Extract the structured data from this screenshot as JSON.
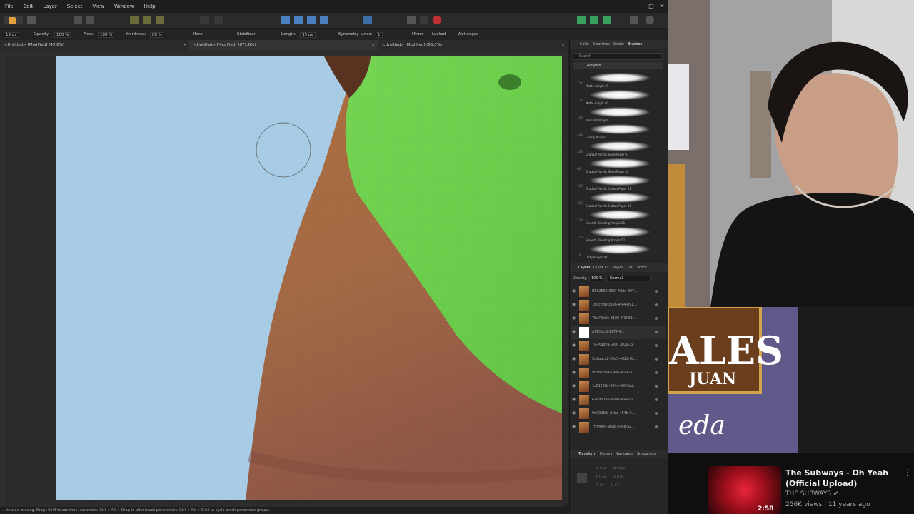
{
  "menu": [
    "File",
    "Edit",
    "Layer",
    "Select",
    "View",
    "Window",
    "Help"
  ],
  "window_controls": {
    "minimize": "–",
    "maximize": "□",
    "close": "✕"
  },
  "context": {
    "size_value": "19 px",
    "opacity_label": "Opacity:",
    "opacity_value": "100 %",
    "flow_label": "Flow:",
    "flow_value": "100 %",
    "hardness_label": "Hardness:",
    "hardness_value": "80 %",
    "more_label": "More",
    "stabilizer_label": "Stabilizer",
    "length_label": "Length:",
    "length_value": "35 px",
    "symmetry_label": "Symmetry",
    "lines_label": "Lines:",
    "lines_value": "1",
    "mirror_label": "Mirror",
    "locked_label": "Locked",
    "wet_edges_label": "Wet edges"
  },
  "doc_tabs": [
    {
      "title": "<Untitled> [Modified] (43.8%)",
      "close": "×"
    },
    {
      "title": "<Untitled> [Modified] (871.6%)",
      "close": "×"
    },
    {
      "title": "<Untitled> [Modified] (55.3%)",
      "close": "×"
    }
  ],
  "status_text": "... to start erasing. Drag+Shift to continue last stroke. Ctrl + Alt + Drag to alter brush parameters. Ctrl + Alt + Click to cycle brush parameter groups.",
  "panel_top_tabs": [
    "Color",
    "Swatches",
    "Stroke",
    "Brushes"
  ],
  "brush_search_placeholder": "Search",
  "brush_category": "Acrylics",
  "brushes": [
    {
      "num": "128",
      "name": "Matte Acrylic 01"
    },
    {
      "num": "128",
      "name": "Matte Acrylic 02"
    },
    {
      "num": "140",
      "name": "Textured Acrylic"
    },
    {
      "num": "128",
      "name": "Grainy Acrylic"
    },
    {
      "num": "128",
      "name": "Gradual Acrylic Seed Paper 01"
    },
    {
      "num": "60",
      "name": "Gradual Acrylic Seed Paper 02"
    },
    {
      "num": "128",
      "name": "Gradual Acrylic Cotton Paper 01"
    },
    {
      "num": "128",
      "name": "Gradual Acrylic Cotton Paper 02"
    },
    {
      "num": "128",
      "name": "Smooth Blending Acrylic 01"
    },
    {
      "num": "120",
      "name": "Smooth Blending Acrylic 02"
    },
    {
      "num": "72",
      "name": "Dirty Acrylic 01"
    }
  ],
  "layer_tabs": [
    "Layers",
    "Quick FX",
    "Styles",
    "Tilt",
    "Stock"
  ],
  "layer_opacity_label": "Opacity:",
  "layer_opacity_value": "100 %",
  "blend_mode": "Normal",
  "layers": [
    "ff3b2509-0f80-48dd-807...",
    "160cfd6f-3e26-4fe4-891...",
    "78a79e8e-8108-4f1f-93...",
    "a795fcc8-2177-4...",
    "1bd5447d-b881-454b-9...",
    "5d2aacc2-24a5-4022-82...",
    "95a87504-1a88-4c48-a...",
    "1c81238c-364c-48fd-bd...",
    "42693056-e5bd-466a-b...",
    "9d0926fb-d1ba-454b-9...",
    "7ff6fb00-98ab-34c8-a2..."
  ],
  "bottom_tabs": [
    "Transform",
    "History",
    "Navigator",
    "Snapshots"
  ],
  "transform_fields": [
    "X:",
    "0 px",
    "W:",
    "0 px",
    "Y:",
    "0 px",
    "H:",
    "0 px",
    "R:",
    "0 °",
    "S:",
    "0 °"
  ],
  "poster_text": {
    "big": "ALES",
    "sub": "JUAN",
    "script": "eda"
  },
  "youtube": {
    "title": "The Subways - Oh Yeah (Official Upload)",
    "channel": "THE SUBWAYS",
    "meta": "256K views · 11 years ago",
    "duration": "2:58",
    "more": "⋮",
    "verified": "✔"
  },
  "colors": {
    "sky": "#a9cde6",
    "green": "#72d44f",
    "skin": "#a86a3f",
    "panel_bg": "#262626",
    "accent": "#4a90d9"
  }
}
